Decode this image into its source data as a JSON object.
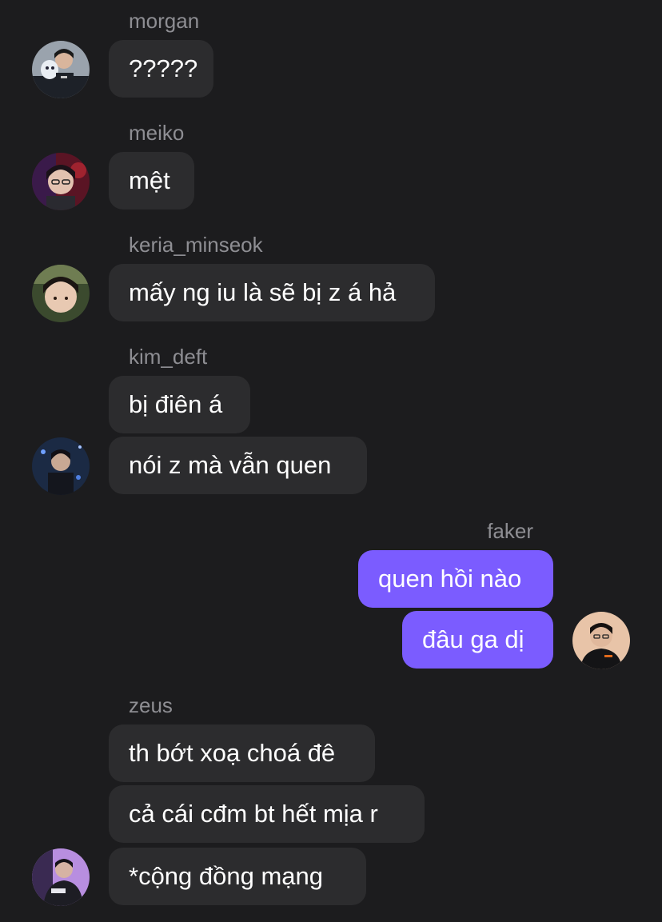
{
  "colors": {
    "background": "#1c1c1e",
    "bubble_incoming": "#2c2c2e",
    "bubble_outgoing": "#7b5cff",
    "sender_name": "#8e8e93",
    "text": "#ffffff"
  },
  "thread": {
    "morgan": {
      "sender": "morgan",
      "messages": [
        "?????"
      ]
    },
    "meiko": {
      "sender": "meiko",
      "messages": [
        "mệt"
      ]
    },
    "keria": {
      "sender": "keria_minseok",
      "messages": [
        "mấy ng iu là sẽ bị z á hả"
      ]
    },
    "deft": {
      "sender": "kim_deft",
      "messages": [
        "bị điên á",
        "nói z mà vẫn quen"
      ]
    },
    "faker": {
      "sender": "faker",
      "messages": [
        "quen hồi nào",
        "đâu ga dị"
      ]
    },
    "zeus": {
      "sender": "zeus",
      "messages": [
        "th bớt xoạ choá đê",
        "cả cái cđm bt hết mịa r",
        "*cộng đồng mạng"
      ]
    }
  }
}
